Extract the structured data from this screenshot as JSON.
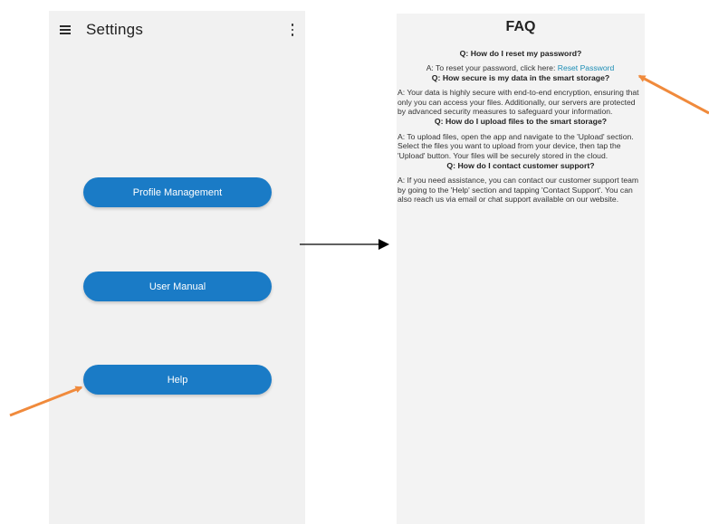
{
  "settings_screen": {
    "title": "Settings",
    "menu_icon": "hamburger-menu-icon",
    "overflow_icon": "more-vertical-icon",
    "buttons": [
      {
        "label": "Profile Management"
      },
      {
        "label": "User Manual"
      },
      {
        "label": "Help"
      }
    ],
    "button_color": "#1a7bc6"
  },
  "faq_screen": {
    "title": "FAQ",
    "items": [
      {
        "question": "Q: How do I reset my password?",
        "answer_prefix": "A: To reset your password, click here: ",
        "answer_link": "Reset Password"
      },
      {
        "question": "Q: How secure is my data in the smart storage?",
        "answer": "A: Your data is highly secure with end-to-end encryption, ensuring that only you can access your files. Additionally, our servers are protected by advanced security measures to safeguard your information."
      },
      {
        "question": "Q: How do I upload files to the smart storage?",
        "answer": "A: To upload files, open the app and navigate to the 'Upload' section. Select the files you want to upload from your device, then tap the 'Upload' button. Your files will be securely stored in the cloud."
      },
      {
        "question": "Q: How do I contact customer support?",
        "answer": "A: If you need assistance, you can contact our customer support team by going to the 'Help' section and tapping 'Contact Support'. You can also reach us via email or chat support available on our website."
      }
    ],
    "link_color": "#1b8db5"
  },
  "annotations": {
    "highlight_arrow_color": "#f08a3c",
    "transition_arrow_color": "#000000"
  }
}
